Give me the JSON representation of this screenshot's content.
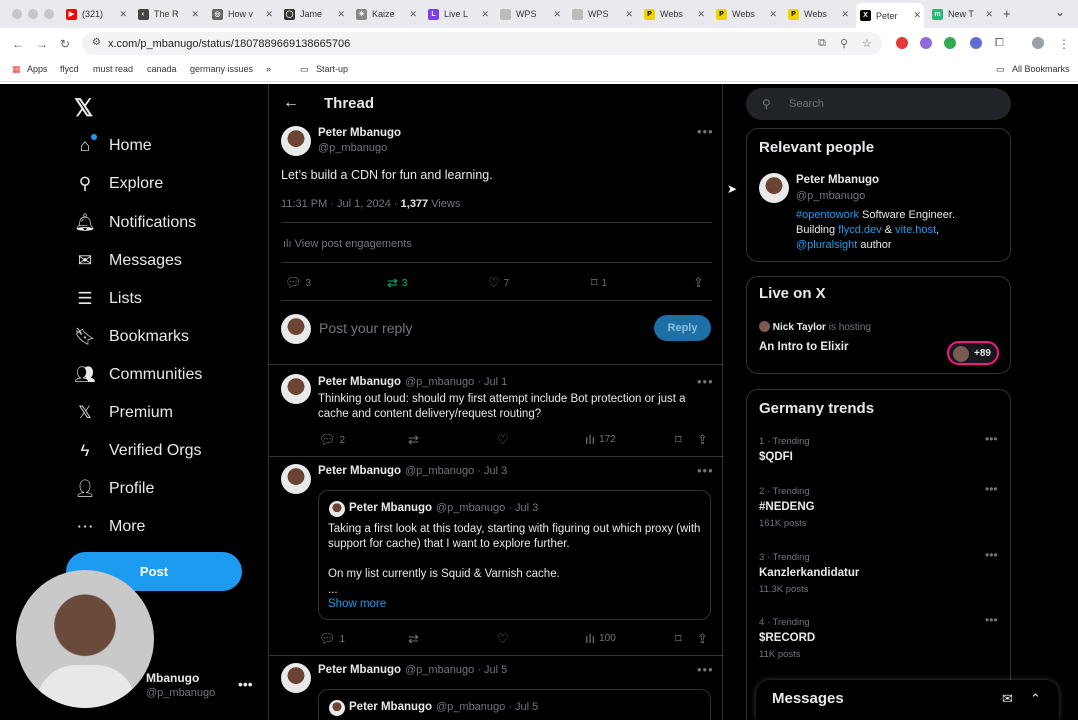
{
  "browser": {
    "tabs": [
      {
        "label": "(321)",
        "color": "#ff0000",
        "glyph": "▶"
      },
      {
        "label": "The R",
        "color": "#444444",
        "glyph": "◐"
      },
      {
        "label": "How v",
        "color": "#666666",
        "glyph": "◎"
      },
      {
        "label": "Jame",
        "color": "#333333",
        "glyph": "◯"
      },
      {
        "label": "Kaize",
        "color": "#888888",
        "glyph": "✳"
      },
      {
        "label": "Live L",
        "color": "#7b3fe4",
        "glyph": "L"
      },
      {
        "label": "WPS",
        "color": "#bbbbbb",
        "glyph": ""
      },
      {
        "label": "WPS",
        "color": "#bbbbbb",
        "glyph": ""
      },
      {
        "label": "Webs",
        "color": "#f0d400",
        "glyph": "P"
      },
      {
        "label": "Webs",
        "color": "#f0d400",
        "glyph": "P"
      },
      {
        "label": "Webs",
        "color": "#f0d400",
        "glyph": "P"
      },
      {
        "label": "Peter",
        "color": "#000000",
        "glyph": "X"
      },
      {
        "label": "New T",
        "color": "#1dbf73",
        "glyph": "m"
      }
    ],
    "url": "x.com/p_mbanugo/status/1807889669138665706",
    "bookmarks": [
      "Apps",
      "flycd",
      "must read",
      "canada",
      "germany issues",
      "»",
      "Start-up"
    ],
    "all_bookmarks": "All Bookmarks"
  },
  "nav": {
    "items": [
      {
        "label": "Home",
        "icon": "⌂"
      },
      {
        "label": "Explore",
        "icon": "⚲"
      },
      {
        "label": "Notifications",
        "icon": "🔔︎"
      },
      {
        "label": "Messages",
        "icon": "✉"
      },
      {
        "label": "Lists",
        "icon": "☰"
      },
      {
        "label": "Bookmarks",
        "icon": "🔖︎"
      },
      {
        "label": "Communities",
        "icon": "👥︎"
      },
      {
        "label": "Premium",
        "icon": "𝕏"
      },
      {
        "label": "Verified Orgs",
        "icon": "ϟ"
      },
      {
        "label": "Profile",
        "icon": "👤︎"
      },
      {
        "label": "More",
        "icon": "⋯"
      }
    ],
    "post": "Post",
    "account_name": "Mbanugo",
    "account_handle": "@p_mbanugo",
    "logo": "𝕏"
  },
  "thread": {
    "title": "Thread",
    "post": {
      "name": "Peter Mbanugo",
      "handle": "@p_mbanugo",
      "text": "Let’s build a CDN for fun and learning.",
      "time": "11:31 PM · Jul 1, 2024 · ",
      "views_count": "1,377",
      "views_label": " Views",
      "engagements": "View post engagements",
      "replies": "3",
      "reposts": "3",
      "likes": "7",
      "bookmarks": "1"
    },
    "reply_placeholder": "Post your reply",
    "reply_button": "Reply",
    "replies": [
      {
        "name": "Peter Mbanugo",
        "meta": "@p_mbanugo · Jul 1",
        "text": "Thinking out loud: should my first attempt include Bot protection or just a cache and content delivery/request routing?",
        "replies": "2",
        "views": "172"
      },
      {
        "name": "Peter Mbanugo",
        "meta": "@p_mbanugo · Jul 3",
        "quote_name": "Peter Mbanugo",
        "quote_meta": "@p_mbanugo · Jul 3",
        "quote_text_1": "Taking a first look at this today, starting with figuring out which proxy (with support for cache) that I want to explore further.",
        "quote_text_2": "On my list currently is Squid & Varnish cache.",
        "quote_ellipsis": "...",
        "show_more": "Show more",
        "replies": "1",
        "views": "100"
      },
      {
        "name": "Peter Mbanugo",
        "meta": "@p_mbanugo · Jul 5",
        "quote_name": "Peter Mbanugo",
        "quote_meta": "@p_mbanugo · Jul 5"
      }
    ]
  },
  "sidebar": {
    "search_placeholder": "Search",
    "relevant": {
      "title": "Relevant people",
      "name": "Peter Mbanugo",
      "handle": "@p_mbanugo",
      "bio_link1": "#opentowork",
      "bio_t1": " Software Engineer.",
      "bio_t2": "Building ",
      "bio_link2": "flycd.dev",
      "bio_t3": " & ",
      "bio_link3": "vite.host",
      "bio_t4": ",",
      "bio_link4": "@pluralsight",
      "bio_t5": " author"
    },
    "live": {
      "title": "Live on X",
      "host": "Nick Taylor",
      "hosting": " is hosting",
      "space": "An Intro to Elixir",
      "count": "+89"
    },
    "trends": {
      "title": "Germany trends",
      "items": [
        {
          "meta": "1 · Trending",
          "name": "$QDFI",
          "posts": ""
        },
        {
          "meta": "2 · Trending",
          "name": "#NEDENG",
          "posts": "161K posts"
        },
        {
          "meta": "3 · Trending",
          "name": "Kanzlerkandidatur",
          "posts": "11.3K posts"
        },
        {
          "meta": "4 · Trending",
          "name": "$RECORD",
          "posts": "11K posts"
        }
      ]
    },
    "messages": "Messages"
  },
  "colors": {
    "accent": "#1d9bf0",
    "repost_green": "#00ba7c",
    "live_pink": "#f91880"
  }
}
